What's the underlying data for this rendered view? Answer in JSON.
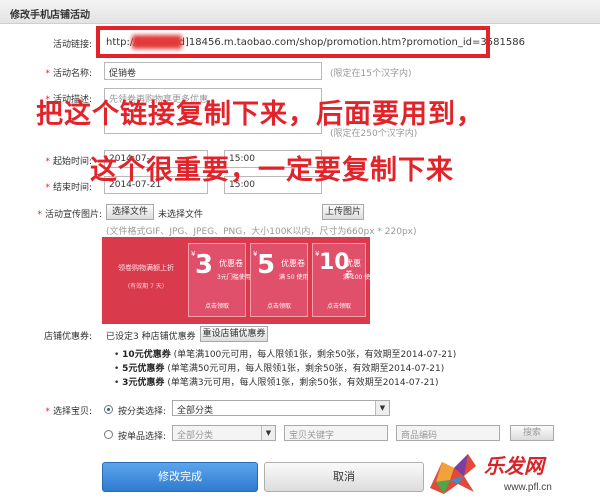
{
  "window": {
    "title": "修改手机店铺活动"
  },
  "form": {
    "link": {
      "label": "活动链接:",
      "url": "http://[redacted]18456.m.taobao.com/shop/promotion.htm?promotion_id=3581586"
    },
    "name": {
      "label": "活动名称:",
      "value": "促销卷",
      "hint": "(限定在15个汉字内)"
    },
    "desc": {
      "label": "活动描述:",
      "value": "先领卷再购物享更多优惠",
      "hint": "(限定在250个汉字内)"
    },
    "start": {
      "label": "起始时间:",
      "date": "2014-07-",
      "time": "15:00"
    },
    "end": {
      "label": "结束时间:",
      "date": "2014-07-21",
      "time": "15:00"
    },
    "image": {
      "label": "活动宣传图片:",
      "choose_button": "选择文件",
      "no_file": "未选择文件",
      "upload_button": "上传图片",
      "hint": "(文件格式GIF、JPG、JPEG、PNG，大小100K以内，尺寸为660px * 220px)"
    },
    "coupons": {
      "label": "店铺优惠券:",
      "status": "已设定3 种店铺优惠券",
      "reset_button": "重设店铺优惠券",
      "items": [
        {
          "amount": "10元优惠券",
          "detail": "(单笔满100元可用，每人限领1张，剩余50张，有效期至2014-07-21)"
        },
        {
          "amount": "5元优惠券",
          "detail": "(单笔满50元可用，每人限领1张，剩余50张，有效期至2014-07-21)"
        },
        {
          "amount": "3元优惠券",
          "detail": "(单笔满3元可用，每人限领1张，剩余50张，有效期至2014-07-21)"
        }
      ]
    },
    "items": {
      "label": "选择宝贝:",
      "by_category_label": "按分类选择:",
      "by_category_value": "全部分类",
      "by_item_label": "按单品选择:",
      "by_item_category": "全部分类",
      "keyword_placeholder": "宝贝关键字",
      "code_placeholder": "商品编码",
      "search_button": "搜索"
    },
    "submit_button": "修改完成",
    "cancel_button": "取消"
  },
  "banner": {
    "left_text": "领卷购物满额上折",
    "left_sub": "(有效期 7 天)",
    "coupons": [
      {
        "value": "3",
        "name": "优惠卷",
        "sub": "3元门槛使用",
        "use": "点击领取"
      },
      {
        "value": "5",
        "name": "优惠卷",
        "sub": "满 50 使用",
        "use": "点击领取"
      },
      {
        "value": "10",
        "name": "优惠卷",
        "sub": "满 100 使用",
        "use": "点击领取"
      }
    ],
    "yen": "¥"
  },
  "annotation": {
    "line1": "把这个链接复制下来，后面要用到，",
    "line2": "这个很重要，一定要复制下来"
  },
  "watermark": {
    "brand": "乐发网",
    "site": "www.pfl.cn"
  },
  "colors": {
    "accent_red": "#e2242a",
    "primary_blue": "#2f7bd0",
    "banner_red": "#d93a4c"
  }
}
